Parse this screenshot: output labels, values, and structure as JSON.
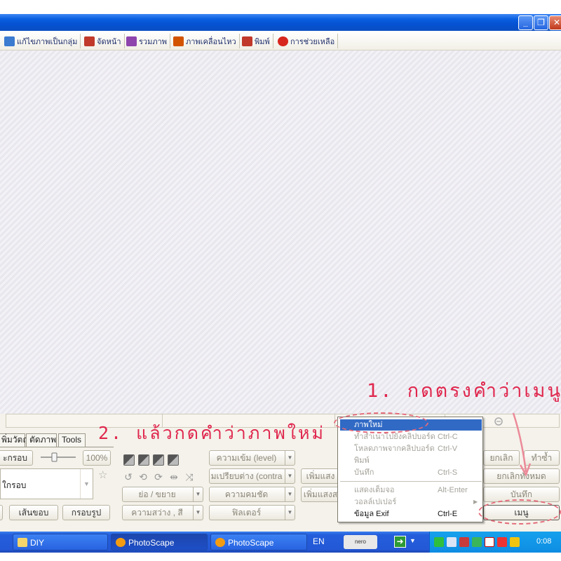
{
  "window": {
    "min_glyph": "_",
    "max_glyph": "❐",
    "close_glyph": "✕"
  },
  "menu": [
    {
      "label": "แก้ไขภาพเป็นกลุ่ม",
      "icon": "batch-edit-icon",
      "color": "#3b7bd0"
    },
    {
      "label": "จัดหน้า",
      "icon": "page-layout-icon",
      "color": "#c0392b"
    },
    {
      "label": "รวมภาพ",
      "icon": "combine-icon",
      "color": "#8e44ad"
    },
    {
      "label": "ภาพเคลื่อนไหว",
      "icon": "animated-gif-icon",
      "color": "#d35400"
    },
    {
      "label": "พิมพ์",
      "icon": "print-icon",
      "color": "#c0392b"
    },
    {
      "label": "การช่วยเหลือ",
      "icon": "help-icon",
      "color": "#d7261e"
    }
  ],
  "tabs": {
    "object": "พิ่มวัตถุ",
    "crop": "ตัดภาพ",
    "tools": "Tools"
  },
  "left_panel": {
    "frame_button": "ะกรอบ",
    "zoom_percent": "100%",
    "frame_select": "ใกรอบ",
    "line_button": "เส้นขอบ",
    "shape_frame_button": "กรอบรูป"
  },
  "mid_panel": {
    "resize": "ย่อ / ขยาย",
    "brightness": "ความสว่าง , สี",
    "level": "ความเข้ม (level)",
    "contrast": "มเปรียบต่าง (contra",
    "sharpen": "ความคมชัด",
    "filter": "ฟิลเตอร์",
    "add_light1": "เพิ่มแสง",
    "add_light2": "เพิ่มแสงส"
  },
  "right_panel": {
    "cancel": "ยกเลิก",
    "redo": "ทำซ้ำ",
    "cancel_all": "ยกเลิกทั้งหมด",
    "save": "บันทึก",
    "menu": "เมนู"
  },
  "context_menu": {
    "new_image": "ภาพใหม่",
    "copy": "ทำสำเนาไปยังคลิปบอร์ด",
    "copy_sc": "Ctrl-C",
    "paste": "โหลดภาพจากคลิปบอร์ด",
    "paste_sc": "Ctrl-V",
    "print": "พิมพ์",
    "save": "บันทึก",
    "save_sc": "Ctrl-S",
    "fullscreen": "แสดงเต็มจอ",
    "fullscreen_sc": "Alt-Enter",
    "wallpaper": "วอลล์เปเปอร์",
    "exif": "ข้อมูล Exif",
    "exif_sc": "Ctrl-E"
  },
  "annotations": {
    "step1": "1. กดตรงคำว่าเมนู",
    "step2": "2. แล้วกดคำว่าภาพใหม่"
  },
  "taskbar": {
    "diy": "DIY",
    "photoscape1": "PhotoScape",
    "photoscape2": "PhotoScape",
    "lang": "EN",
    "nero": "nero SEARCH",
    "clock": "0:08"
  }
}
